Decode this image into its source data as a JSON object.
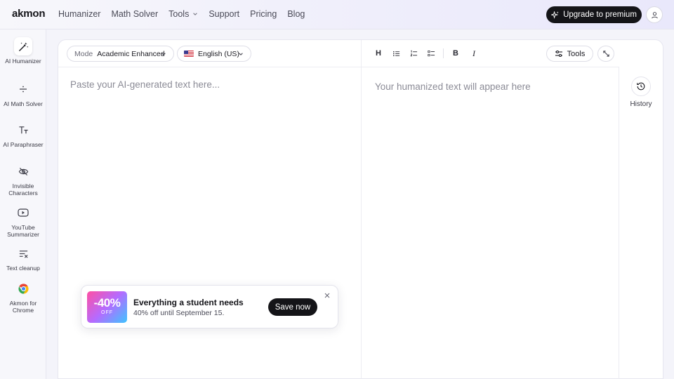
{
  "topbar": {
    "logo": "akmon",
    "nav": [
      {
        "label": "Humanizer"
      },
      {
        "label": "Math Solver"
      },
      {
        "label": "Tools"
      },
      {
        "label": "Support"
      },
      {
        "label": "Pricing"
      },
      {
        "label": "Blog"
      }
    ],
    "upgrade_label": "Upgrade to premium"
  },
  "sidebar": {
    "items": [
      {
        "label": "AI Humanizer",
        "icon": "magic-wand-icon",
        "active": true
      },
      {
        "label": "AI Math Solver",
        "icon": "divide-icon"
      },
      {
        "label": "AI Paraphraser",
        "icon": "text-size-icon"
      },
      {
        "label": "Invisible Characters",
        "icon": "eye-off-icon"
      },
      {
        "label": "YouTube Summarizer",
        "icon": "youtube-icon"
      },
      {
        "label": "Text cleanup",
        "icon": "text-clear-icon"
      },
      {
        "label": "Akmon for Chrome",
        "icon": "chrome-icon"
      }
    ]
  },
  "editor": {
    "mode_label": "Mode",
    "mode_value": "Academic Enhanced",
    "language": "English (US)",
    "input_placeholder": "Paste your AI-generated text here...",
    "output_placeholder": "Your humanized text will appear here",
    "toolbar": {
      "heading": "H",
      "bold": "B",
      "italic": "I",
      "tools_label": "Tools"
    },
    "history_label": "History"
  },
  "promo": {
    "discount": "-40%",
    "off": "OFF",
    "title": "Everything a student needs",
    "subtitle": "40% off until September 15.",
    "cta": "Save now"
  },
  "colors": {
    "accent_dark": "#141418",
    "muted_text": "#8b8b96"
  }
}
